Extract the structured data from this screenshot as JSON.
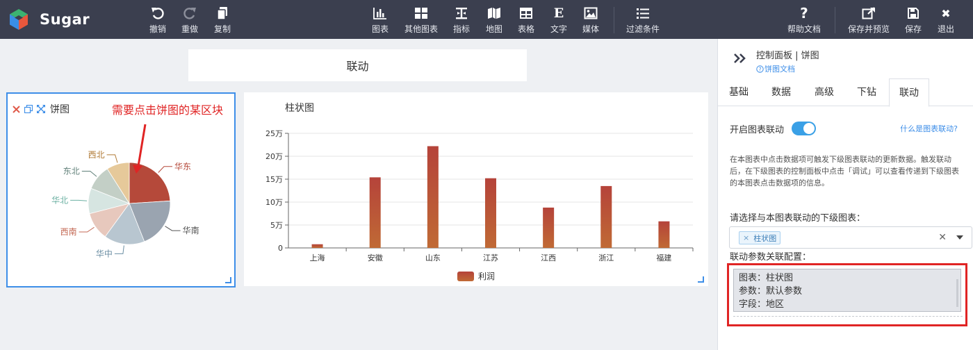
{
  "app": {
    "name": "Sugar"
  },
  "toolbar": {
    "left": [
      {
        "label": "撤销",
        "icon": "undo-icon"
      },
      {
        "label": "重做",
        "icon": "redo-icon"
      },
      {
        "label": "复制",
        "icon": "copy-icon"
      }
    ],
    "center": [
      {
        "label": "图表",
        "icon": "bar-chart-icon"
      },
      {
        "label": "其他图表",
        "icon": "grid-icon"
      },
      {
        "label": "指标",
        "icon": "indicator-icon"
      },
      {
        "label": "地图",
        "icon": "map-icon"
      },
      {
        "label": "表格",
        "icon": "table-icon"
      },
      {
        "label": "文字",
        "icon": "text-icon",
        "glyph": "E"
      },
      {
        "label": "媒体",
        "icon": "image-icon"
      }
    ],
    "filter": {
      "label": "过滤条件",
      "icon": "list-icon"
    },
    "right": [
      {
        "label": "帮助文档",
        "icon": "help-icon",
        "glyph": "?"
      },
      {
        "label": "保存并预览",
        "icon": "external-link-icon"
      },
      {
        "label": "保存",
        "icon": "save-icon"
      },
      {
        "label": "退出",
        "icon": "close-icon",
        "glyph": "✖"
      }
    ]
  },
  "canvas": {
    "title": "联动",
    "pie_card": {
      "title": "饼图",
      "annotation": "需要点击饼图的某区块",
      "tool_icons": [
        "delete-icon",
        "copy-icon",
        "expand-icon"
      ]
    },
    "bar_card": {
      "title": "柱状图"
    }
  },
  "chart_data": [
    {
      "type": "pie",
      "title": "饼图",
      "labels": [
        "华东",
        "华南",
        "华中",
        "西南",
        "华北",
        "东北",
        "西北"
      ],
      "values": [
        24,
        20,
        16,
        11,
        10,
        10,
        9
      ],
      "colors": [
        "#b5493a",
        "#9aa4b0",
        "#b8c6d0",
        "#e7c8bd",
        "#d6e5e1",
        "#c3cfc6",
        "#e6c99a"
      ],
      "label_colors": [
        "#b5493a",
        "#555555",
        "#6b8ea3",
        "#c46a55",
        "#6bb0a2",
        "#5f7f78",
        "#b07a35"
      ]
    },
    {
      "type": "bar",
      "title": "柱状图",
      "categories": [
        "上海",
        "安徽",
        "山东",
        "江苏",
        "江西",
        "浙江",
        "福建"
      ],
      "series": [
        {
          "name": "利润",
          "values": [
            8000,
            154000,
            222000,
            152000,
            88000,
            135000,
            58000
          ]
        }
      ],
      "yticks": [
        "0",
        "5万",
        "10万",
        "15万",
        "20万",
        "25万"
      ],
      "ylim": [
        0,
        250000
      ],
      "grid": true,
      "legend": "bottom",
      "color_top": "#b5433a",
      "color_bottom": "#c06a35"
    }
  ],
  "panel": {
    "title": "控制面板 | 饼图",
    "doc_link": "饼图文档",
    "tabs": [
      "基础",
      "数据",
      "高级",
      "下钻",
      "联动"
    ],
    "active_tab": "联动",
    "toggle_label": "开启图表联动",
    "toggle_on": true,
    "help_link": "什么是图表联动?",
    "description": "在本图表中点击数据项可触发下级图表联动的更新数据。触发联动后，在下级图表的控制面板中点击「调试」可以查看传递到下级图表的本图表点击数据项的信息。",
    "select_label": "请选择与本图表联动的下级图表：",
    "selected_tag": "柱状图",
    "param_label": "联动参数关联配置：",
    "config_lines": [
      "图表：柱状图",
      "参数：默认参数",
      "字段：地区"
    ]
  }
}
